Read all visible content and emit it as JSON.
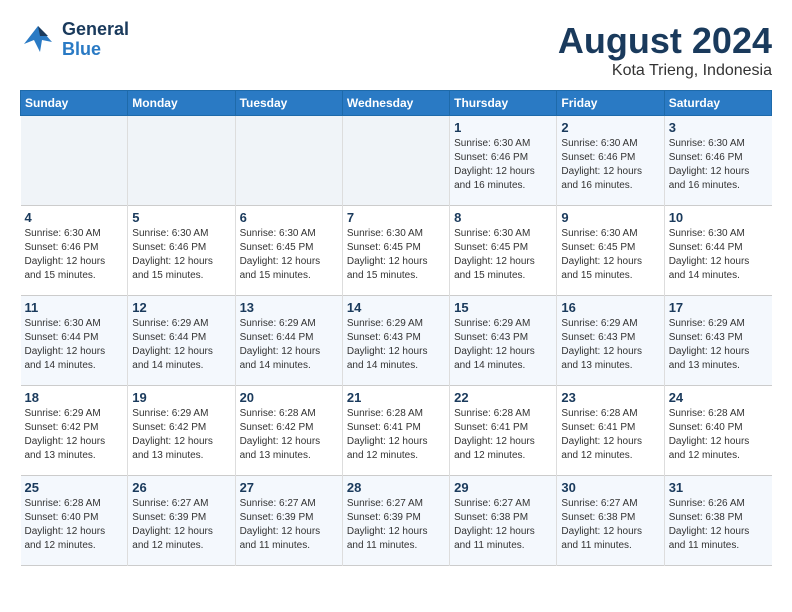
{
  "header": {
    "logo_line1": "General",
    "logo_line2": "Blue",
    "month_year": "August 2024",
    "location": "Kota Trieng, Indonesia"
  },
  "weekdays": [
    "Sunday",
    "Monday",
    "Tuesday",
    "Wednesday",
    "Thursday",
    "Friday",
    "Saturday"
  ],
  "weeks": [
    [
      {
        "day": "",
        "sunrise": "",
        "sunset": "",
        "daylight": "",
        "empty": true
      },
      {
        "day": "",
        "sunrise": "",
        "sunset": "",
        "daylight": "",
        "empty": true
      },
      {
        "day": "",
        "sunrise": "",
        "sunset": "",
        "daylight": "",
        "empty": true
      },
      {
        "day": "",
        "sunrise": "",
        "sunset": "",
        "daylight": "",
        "empty": true
      },
      {
        "day": "1",
        "sunrise": "6:30 AM",
        "sunset": "6:46 PM",
        "daylight": "12 hours and 16 minutes."
      },
      {
        "day": "2",
        "sunrise": "6:30 AM",
        "sunset": "6:46 PM",
        "daylight": "12 hours and 16 minutes."
      },
      {
        "day": "3",
        "sunrise": "6:30 AM",
        "sunset": "6:46 PM",
        "daylight": "12 hours and 16 minutes."
      }
    ],
    [
      {
        "day": "4",
        "sunrise": "6:30 AM",
        "sunset": "6:46 PM",
        "daylight": "12 hours and 15 minutes."
      },
      {
        "day": "5",
        "sunrise": "6:30 AM",
        "sunset": "6:46 PM",
        "daylight": "12 hours and 15 minutes."
      },
      {
        "day": "6",
        "sunrise": "6:30 AM",
        "sunset": "6:45 PM",
        "daylight": "12 hours and 15 minutes."
      },
      {
        "day": "7",
        "sunrise": "6:30 AM",
        "sunset": "6:45 PM",
        "daylight": "12 hours and 15 minutes."
      },
      {
        "day": "8",
        "sunrise": "6:30 AM",
        "sunset": "6:45 PM",
        "daylight": "12 hours and 15 minutes."
      },
      {
        "day": "9",
        "sunrise": "6:30 AM",
        "sunset": "6:45 PM",
        "daylight": "12 hours and 15 minutes."
      },
      {
        "day": "10",
        "sunrise": "6:30 AM",
        "sunset": "6:44 PM",
        "daylight": "12 hours and 14 minutes."
      }
    ],
    [
      {
        "day": "11",
        "sunrise": "6:30 AM",
        "sunset": "6:44 PM",
        "daylight": "12 hours and 14 minutes."
      },
      {
        "day": "12",
        "sunrise": "6:29 AM",
        "sunset": "6:44 PM",
        "daylight": "12 hours and 14 minutes."
      },
      {
        "day": "13",
        "sunrise": "6:29 AM",
        "sunset": "6:44 PM",
        "daylight": "12 hours and 14 minutes."
      },
      {
        "day": "14",
        "sunrise": "6:29 AM",
        "sunset": "6:43 PM",
        "daylight": "12 hours and 14 minutes."
      },
      {
        "day": "15",
        "sunrise": "6:29 AM",
        "sunset": "6:43 PM",
        "daylight": "12 hours and 14 minutes."
      },
      {
        "day": "16",
        "sunrise": "6:29 AM",
        "sunset": "6:43 PM",
        "daylight": "12 hours and 13 minutes."
      },
      {
        "day": "17",
        "sunrise": "6:29 AM",
        "sunset": "6:43 PM",
        "daylight": "12 hours and 13 minutes."
      }
    ],
    [
      {
        "day": "18",
        "sunrise": "6:29 AM",
        "sunset": "6:42 PM",
        "daylight": "12 hours and 13 minutes."
      },
      {
        "day": "19",
        "sunrise": "6:29 AM",
        "sunset": "6:42 PM",
        "daylight": "12 hours and 13 minutes."
      },
      {
        "day": "20",
        "sunrise": "6:28 AM",
        "sunset": "6:42 PM",
        "daylight": "12 hours and 13 minutes."
      },
      {
        "day": "21",
        "sunrise": "6:28 AM",
        "sunset": "6:41 PM",
        "daylight": "12 hours and 12 minutes."
      },
      {
        "day": "22",
        "sunrise": "6:28 AM",
        "sunset": "6:41 PM",
        "daylight": "12 hours and 12 minutes."
      },
      {
        "day": "23",
        "sunrise": "6:28 AM",
        "sunset": "6:41 PM",
        "daylight": "12 hours and 12 minutes."
      },
      {
        "day": "24",
        "sunrise": "6:28 AM",
        "sunset": "6:40 PM",
        "daylight": "12 hours and 12 minutes."
      }
    ],
    [
      {
        "day": "25",
        "sunrise": "6:28 AM",
        "sunset": "6:40 PM",
        "daylight": "12 hours and 12 minutes."
      },
      {
        "day": "26",
        "sunrise": "6:27 AM",
        "sunset": "6:39 PM",
        "daylight": "12 hours and 12 minutes."
      },
      {
        "day": "27",
        "sunrise": "6:27 AM",
        "sunset": "6:39 PM",
        "daylight": "12 hours and 11 minutes."
      },
      {
        "day": "28",
        "sunrise": "6:27 AM",
        "sunset": "6:39 PM",
        "daylight": "12 hours and 11 minutes."
      },
      {
        "day": "29",
        "sunrise": "6:27 AM",
        "sunset": "6:38 PM",
        "daylight": "12 hours and 11 minutes."
      },
      {
        "day": "30",
        "sunrise": "6:27 AM",
        "sunset": "6:38 PM",
        "daylight": "12 hours and 11 minutes."
      },
      {
        "day": "31",
        "sunrise": "6:26 AM",
        "sunset": "6:38 PM",
        "daylight": "12 hours and 11 minutes."
      }
    ]
  ],
  "labels": {
    "sunrise_prefix": "Sunrise: ",
    "sunset_prefix": "Sunset: ",
    "daylight_prefix": "Daylight: "
  }
}
